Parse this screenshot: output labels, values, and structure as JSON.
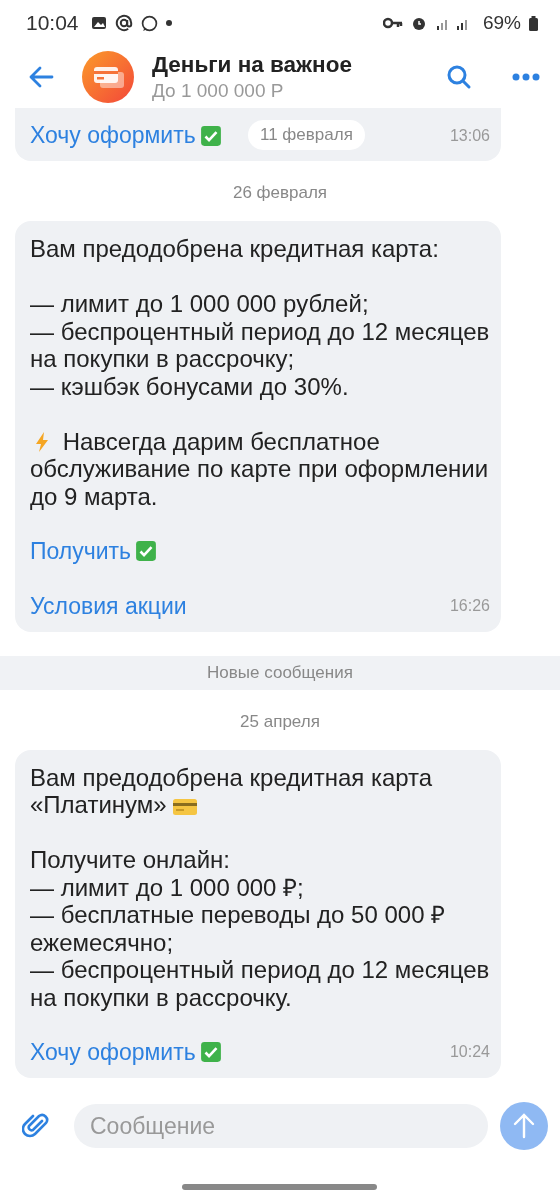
{
  "status_bar": {
    "time": "10:04",
    "battery": "69%"
  },
  "header": {
    "title": "Деньги на важное",
    "subtitle": "До 1 000 000 Р"
  },
  "floating_date": "11 февраля",
  "feed": [
    {
      "kind": "message",
      "clipped": true,
      "links": [
        {
          "text": "Хочу оформить",
          "check": true
        }
      ],
      "time": "13:06"
    },
    {
      "kind": "date",
      "text": "26 февраля"
    },
    {
      "kind": "message",
      "clipped": false,
      "paragraphs": [
        {
          "kind": "plain",
          "text": "Вам предодобрена кредитная карта:"
        },
        {
          "kind": "plain",
          "text": "— лимит до 1 000 000 рублей;\n— беспроцентный период до 12 месяцев на покупки в рассрочку;\n— кэшбэк бонусами до 30%."
        },
        {
          "kind": "bolt",
          "text": "Навсегда дарим бесплатное обслуживание по карте при оформлении до 9 марта."
        }
      ],
      "links": [
        {
          "text": "Получить",
          "check": true
        },
        {
          "text": "Условия акции",
          "check": false
        }
      ],
      "time": "16:26"
    },
    {
      "kind": "divider",
      "text": "Новые сообщения"
    },
    {
      "kind": "date",
      "text": "25 апреля"
    },
    {
      "kind": "message",
      "clipped": false,
      "paragraphs": [
        {
          "kind": "card",
          "text": "Вам предодобрена кредитная карта «Платинум»"
        },
        {
          "kind": "plain",
          "text": "Получите онлайн:\n— лимит до 1 000 000 ₽;\n— бесплатные переводы до 50 000 ₽ ежемесячно;\n— беспроцентный период до 12 месяцев на покупки в рассрочку."
        }
      ],
      "links": [
        {
          "text": "Хочу оформить",
          "check": true
        }
      ],
      "time": "10:24"
    }
  ],
  "composer": {
    "placeholder": "Сообщение"
  }
}
